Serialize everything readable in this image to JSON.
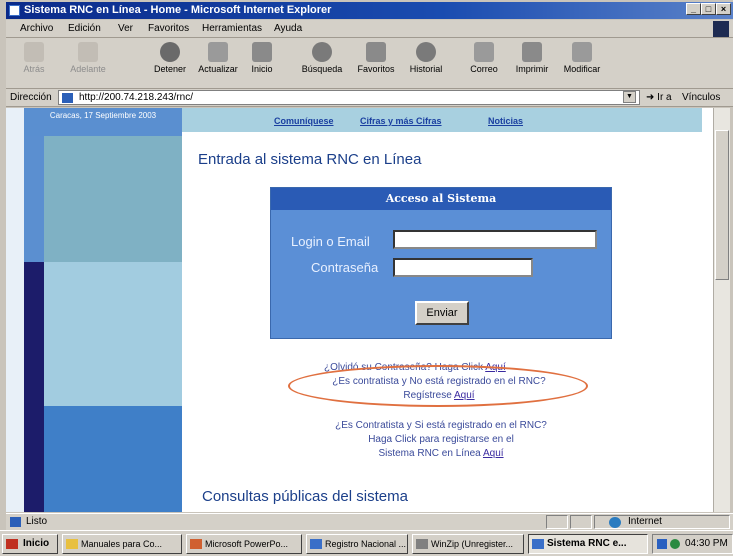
{
  "window": {
    "title": "Sistema RNC en Línea - Home - Microsoft Internet Explorer",
    "controls": [
      "_",
      "□",
      "×"
    ]
  },
  "menu": {
    "items": [
      "Archivo",
      "Edición",
      "Ver",
      "Favoritos",
      "Herramientas",
      "Ayuda"
    ]
  },
  "toolbar": {
    "back": "Atrás",
    "forward": "Adelante",
    "stop": "Detener",
    "refresh": "Actualizar",
    "home": "Inicio",
    "search": "Búsqueda",
    "favorites": "Favoritos",
    "history": "Historial",
    "mail": "Correo",
    "print": "Imprimir",
    "edit": "Modificar"
  },
  "address": {
    "label": "Dirección",
    "url": "http://200.74.218.243/rnc/",
    "go": "Ir a",
    "links": "Vínculos"
  },
  "page": {
    "date": "Caracas, 17 Septiembre 2003",
    "nav": [
      "Comuníquese",
      "Cifras y más Cifras",
      "Noticias"
    ],
    "title": "Entrada al sistema RNC en Línea",
    "login": {
      "heading": "Acceso al Sistema",
      "login_label": "Login o Email",
      "password_label": "Contraseña",
      "submit": "Enviar"
    },
    "forgot": {
      "text": "¿Olvidó su Contraseña? Haga Click",
      "link": "Aquí"
    },
    "not_registered": {
      "line1": "¿Es contratista y No está registrado en el RNC?",
      "line2": "Regístrese",
      "link": "Aquí"
    },
    "registered": {
      "line1": "¿Es Contratista y Si está registrado en el RNC?",
      "line2": "Haga Click para registrarse en el",
      "line3": "Sistema RNC en Línea",
      "link": "Aquí"
    },
    "section_title": "Consultas públicas del sistema"
  },
  "status": {
    "text": "Listo",
    "zone": "Internet"
  },
  "taskbar": {
    "start": "Inicio",
    "tasks": [
      "Manuales para Co...",
      "Microsoft PowerPo...",
      "Registro Nacional ...",
      "WinZip (Unregister...",
      "Sistema RNC e..."
    ],
    "clock": "04:30 PM"
  }
}
